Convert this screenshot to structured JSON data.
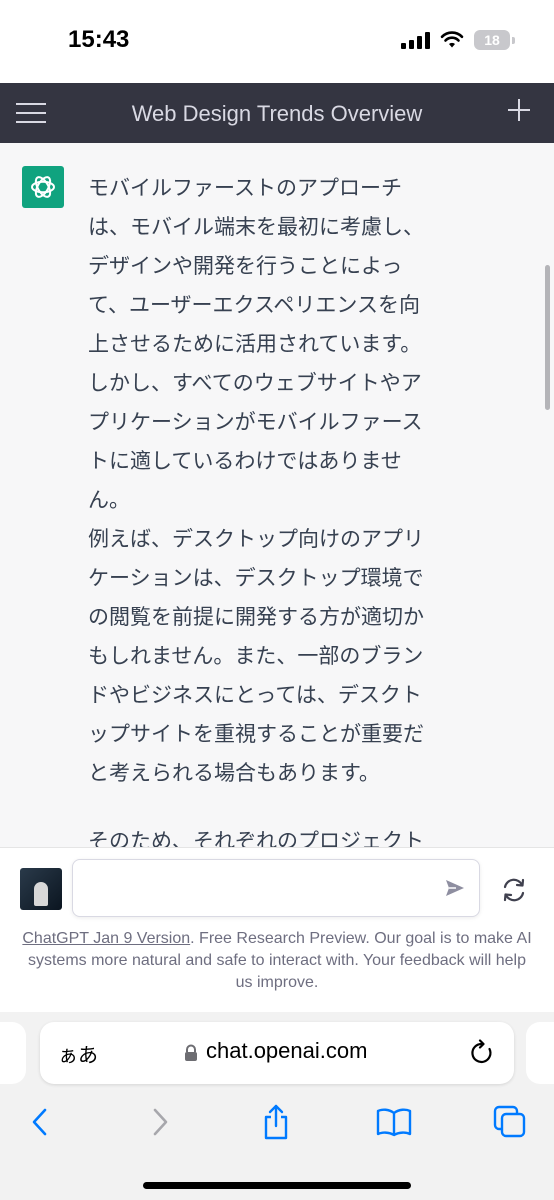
{
  "status_bar": {
    "time": "15:43",
    "battery": "18",
    "icons": [
      "signal-icon",
      "wifi-icon",
      "battery-icon"
    ]
  },
  "header": {
    "title": "Web Design Trends Overview",
    "menu_icon": "hamburger-menu-icon",
    "new_chat_icon": "plus-icon"
  },
  "message": {
    "paragraphs": [
      "モバイルファーストのアプローチは、モバイル端末を最初に考慮し、デザインや開発を行うことによって、ユーザーエクスペリエンスを向上させるために活用されています。しかし、すべてのウェブサイトやアプリケーションがモバイルファーストに適しているわけではありません。",
      "例えば、デスクトップ向けのアプリケーションは、デスクトップ環境での閲覧を前提に開発する方が適切かもしれません。また、一部のブランドやビジネスにとっては、デスクトップサイトを重視することが重要だと考えられる場合もあります。",
      "そのため、それぞれのプロジェクト"
    ]
  },
  "composer": {
    "input_value": "",
    "input_placeholder": "",
    "send_icon": "send-icon",
    "regenerate_icon": "refresh-icon"
  },
  "footer": {
    "link_text": "ChatGPT Jan 9 Version",
    "note": ". Free Research Preview. Our goal is to make AI systems more natural and safe to interact with. Your feedback will help us improve."
  },
  "browser": {
    "aa_label": "ぁあ",
    "url": "chat.openai.com",
    "toolbar_icons": [
      "back-icon",
      "forward-icon",
      "share-icon",
      "bookmarks-icon",
      "tabs-icon"
    ]
  },
  "colors": {
    "header_bg": "#343541",
    "accent": "#10a37f",
    "link": "#007aff"
  }
}
